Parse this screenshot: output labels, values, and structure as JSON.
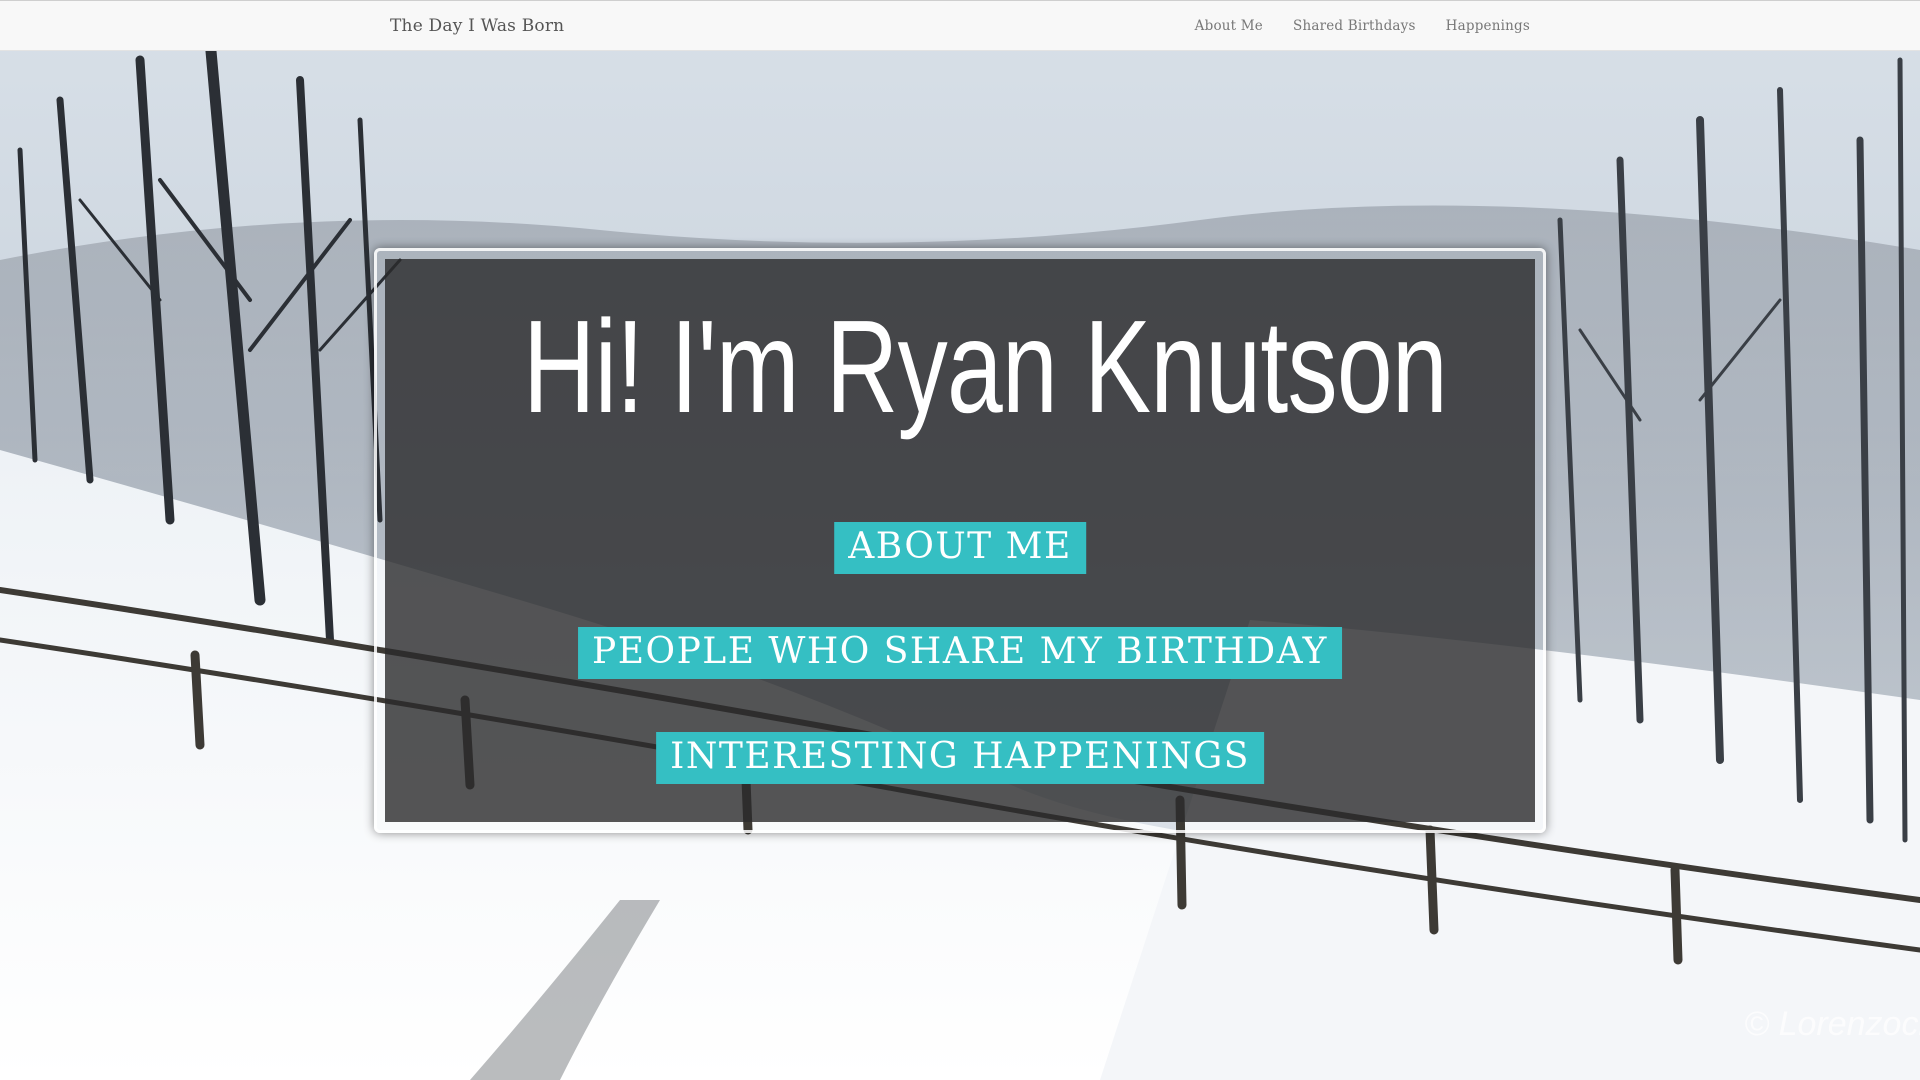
{
  "navbar": {
    "brand": "The Day I Was Born",
    "links": [
      {
        "label": "About Me"
      },
      {
        "label": "Shared Birthdays"
      },
      {
        "label": "Happenings"
      }
    ]
  },
  "hero": {
    "title": "Hi! I'm Ryan Knutson",
    "buttons": [
      {
        "label": "About Me"
      },
      {
        "label": "People Who Share My Birthday"
      },
      {
        "label": "Interesting Happenings"
      }
    ]
  },
  "background": {
    "watermark": "© Lorenzocl"
  },
  "colors": {
    "accent": "#35bfc3",
    "navbar_bg": "#f8f8f8",
    "panel_bg": "#2a2a2c"
  }
}
